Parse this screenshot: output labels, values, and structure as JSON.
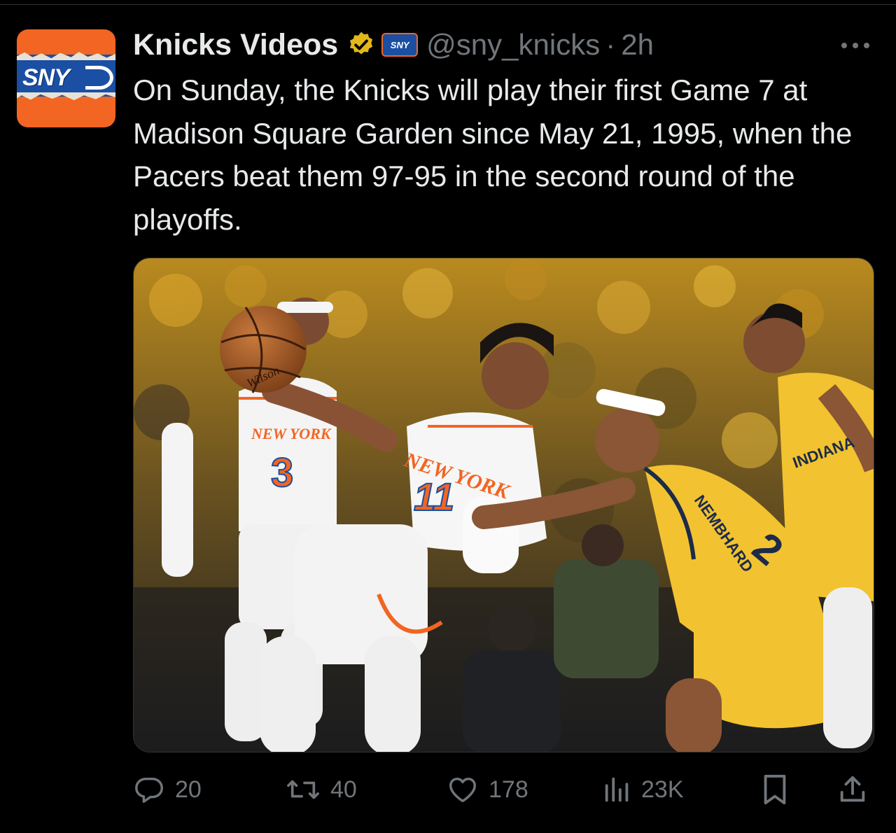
{
  "author": {
    "display_name": "Knicks Videos",
    "avatar_text": "SNY",
    "affiliate_badge_text": "SNY",
    "handle": "@sny_knicks",
    "separator": "·",
    "time": "2h",
    "verified_color": "#e2b719"
  },
  "tweet": {
    "text": "On Sunday, the Knicks will play their first Game 7 at Madison Square Garden since May 21, 1995, when the Pacers beat them 97-95 in the second round of the playoffs."
  },
  "media": {
    "jersey_left_text": "NEW YORK",
    "jersey_left_number": "3",
    "jersey_center_text": "NEW YORK",
    "jersey_center_number": "11",
    "jersey_right_name": "NEMBHARD",
    "jersey_right_number": "2",
    "jersey_far_right_text": "INDIANA",
    "ball_text": "Wilson"
  },
  "actions": {
    "reply": {
      "icon": "reply-icon",
      "count": "20"
    },
    "retweet": {
      "icon": "retweet-icon",
      "count": "40"
    },
    "like": {
      "icon": "heart-icon",
      "count": "178"
    },
    "views": {
      "icon": "views-icon",
      "count": "23K"
    },
    "bookmark": {
      "icon": "bookmark-icon"
    },
    "share": {
      "icon": "share-icon"
    }
  },
  "colors": {
    "background": "#000000",
    "text": "#e7e9ea",
    "muted": "#71767b",
    "knicks_orange": "#f26522",
    "knicks_blue": "#1a4fa3",
    "pacers_gold": "#f2c230",
    "pacers_navy": "#1c2b4a"
  }
}
